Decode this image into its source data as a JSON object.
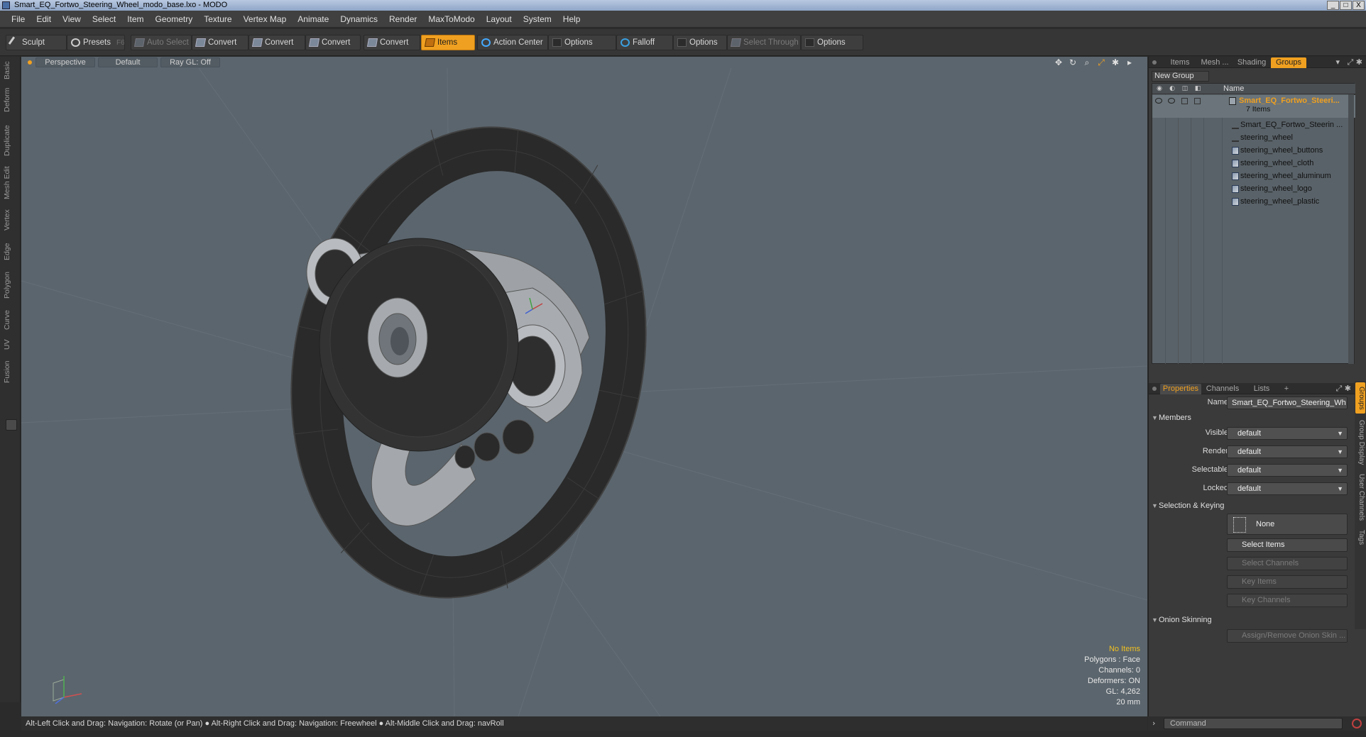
{
  "window": {
    "title": "Smart_EQ_Fortwo_Steering_Wheel_modo_base.lxo - MODO",
    "buttons": [
      "_",
      "□",
      "X"
    ]
  },
  "menu": [
    "File",
    "Edit",
    "View",
    "Select",
    "Item",
    "Geometry",
    "Texture",
    "Vertex Map",
    "Animate",
    "Dynamics",
    "Render",
    "MaxToModo",
    "Layout",
    "System",
    "Help"
  ],
  "toolbar": {
    "sculpt": "Sculpt",
    "presets": "Presets",
    "presets_key": "F6",
    "auto_select": "Auto Select",
    "convert1": "Convert",
    "convert2": "Convert",
    "convert3": "Convert",
    "convert4": "Convert",
    "items": "Items",
    "action_center": "Action Center",
    "options1": "Options",
    "falloff": "Falloff",
    "options2": "Options",
    "select_through": "Select Through",
    "options3": "Options"
  },
  "left_tabs": [
    "Basic",
    "Deform",
    "Duplicate",
    "Mesh Edit",
    "Vertex",
    "Edge",
    "Polygon",
    "Curve",
    "UV",
    "Fusion"
  ],
  "viewport": {
    "view": "Perspective",
    "shading": "Default",
    "raygl": "Ray GL: Off",
    "info": {
      "no_items": "No Items",
      "polygons": "Polygons : Face",
      "channels": "Channels: 0",
      "deformers": "Deformers: ON",
      "gl": "GL: 4,262",
      "scale": "20 mm"
    }
  },
  "status": "Alt-Left Click and Drag: Navigation: Rotate (or Pan) ● Alt-Right Click and Drag: Navigation: Freewheel ● Alt-Middle Click and Drag: navRoll",
  "outliner": {
    "tabs": [
      "Items",
      "Mesh ...",
      "Shading",
      "Groups"
    ],
    "new_group": "New Group",
    "name_col": "Name",
    "group_name": "Smart_EQ_Fortwo_Steeri...",
    "group_count": "7 Items",
    "items": [
      "Smart_EQ_Fortwo_Steerin ...",
      "steering_wheel",
      "steering_wheel_buttons",
      "steering_wheel_cloth",
      "steering_wheel_aluminum",
      "steering_wheel_logo",
      "steering_wheel_plastic"
    ]
  },
  "properties": {
    "tabs": [
      "Properties",
      "Channels",
      "Lists",
      "+"
    ],
    "name_label": "Name",
    "name_value": "Smart_EQ_Fortwo_Steering_Wh",
    "members": "Members",
    "visible_label": "Visible",
    "visible_value": "default",
    "render_label": "Render",
    "render_value": "default",
    "selectable_label": "Selectable",
    "selectable_value": "default",
    "locked_label": "Locked",
    "locked_value": "default",
    "sel_keying": "Selection & Keying",
    "none": "None",
    "select_items": "Select Items",
    "select_channels": "Select Channels",
    "key_items": "Key Items",
    "key_channels": "Key Channels",
    "onion": "Onion Skinning",
    "assign_onion": "Assign/Remove Onion Skin ..."
  },
  "right_vtabs": [
    "Groups",
    "Group Display",
    "User Channels",
    "Tags"
  ],
  "command": {
    "placeholder": "Command"
  },
  "colors": {
    "accent": "#f0a020",
    "viewport_bg": "#5b656d"
  }
}
